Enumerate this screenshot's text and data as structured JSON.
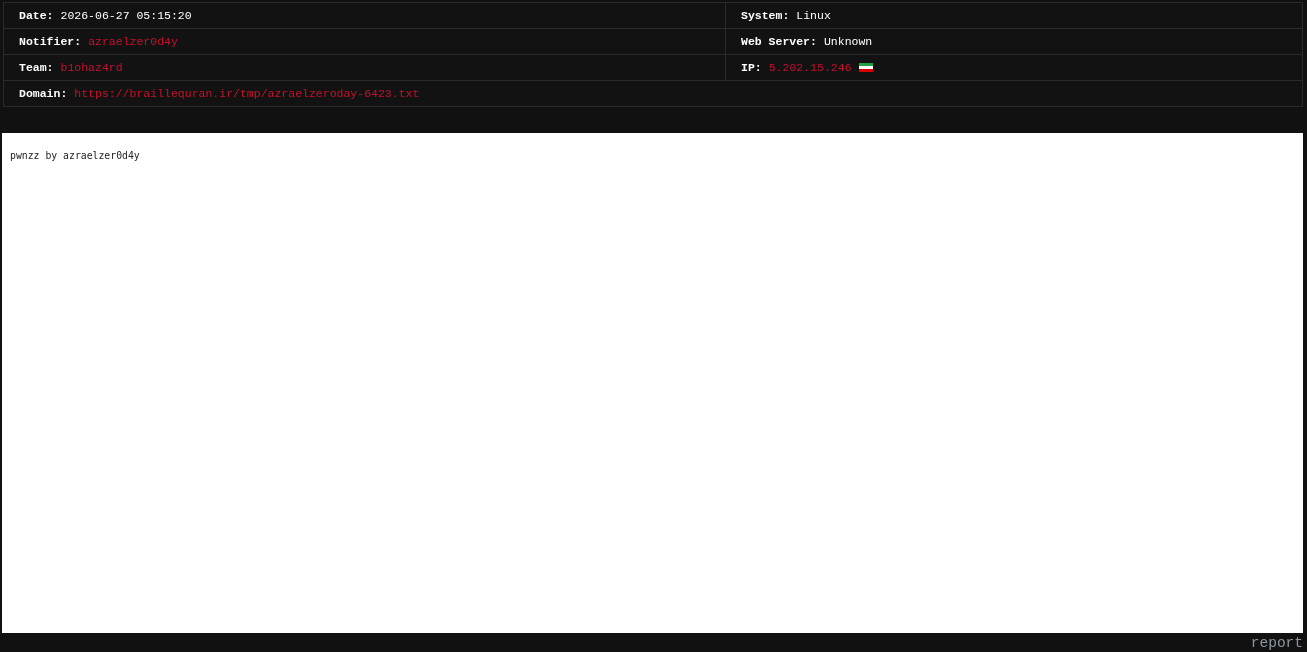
{
  "info_table": {
    "rows": [
      {
        "cells": [
          {
            "label": "Date:",
            "value": "2026-06-27 05:15:20",
            "kind": "text"
          },
          {
            "label": "System:",
            "value": "Linux",
            "kind": "text"
          }
        ]
      },
      {
        "cells": [
          {
            "label": "Notifier:",
            "value": "azraelzer0d4y",
            "kind": "link"
          },
          {
            "label": "Web Server:",
            "value": "Unknown",
            "kind": "text"
          }
        ]
      },
      {
        "cells": [
          {
            "label": "Team:",
            "value": "b1ohaz4rd",
            "kind": "link"
          },
          {
            "label": "IP:",
            "value": "5.202.15.246",
            "kind": "link",
            "flag": true
          }
        ]
      },
      {
        "cells": [
          {
            "label": "Domain:",
            "value": "https://braillequran.ir/tmp/azraelzeroday-6423.txt",
            "kind": "link"
          }
        ]
      }
    ]
  },
  "mirror_frame": {
    "text": "pwnzz by azraelzer0d4y"
  },
  "footer": {
    "link": "report"
  }
}
